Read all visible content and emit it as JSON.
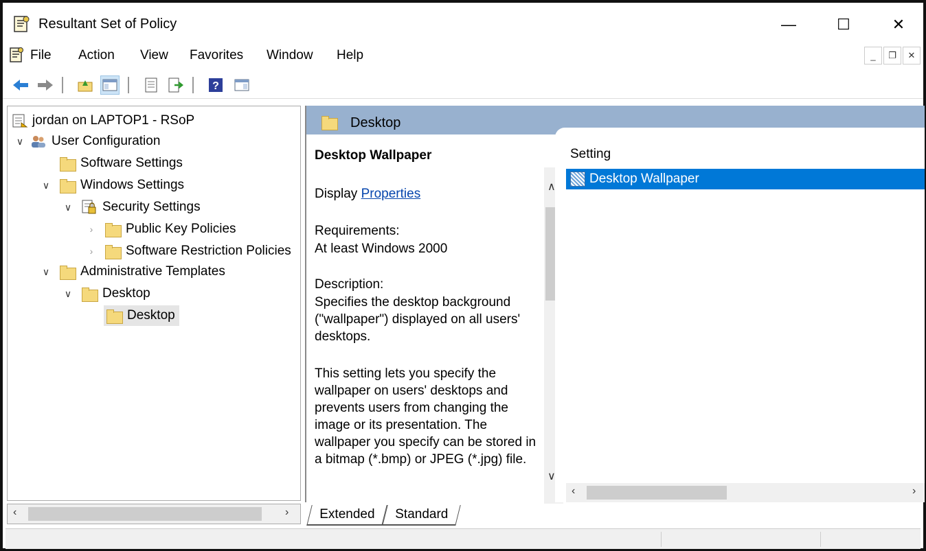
{
  "window": {
    "title": "Resultant Set of Policy",
    "controls": {
      "minimize": "—",
      "maximize": "☐",
      "close": "✕"
    }
  },
  "menu": {
    "items": [
      "File",
      "Action",
      "View",
      "Favorites",
      "Window",
      "Help"
    ],
    "mdi": {
      "minimize": "_",
      "restore": "❐",
      "close": "✕"
    }
  },
  "toolbar": {
    "buttons": [
      "back-arrow-icon",
      "forward-arrow-icon",
      "up-folder-icon",
      "show-hide-tree-icon",
      "properties-icon",
      "export-list-icon",
      "help-icon",
      "show-hide-action-pane-icon"
    ]
  },
  "tree": {
    "root": "jordan on LAPTOP1 - RSoP",
    "user_configuration": "User Configuration",
    "software_settings": "Software Settings",
    "windows_settings": "Windows Settings",
    "security_settings": "Security Settings",
    "public_key_policies": "Public Key Policies",
    "software_restriction": "Software Restriction Policies",
    "administrative_templates": "Administrative Templates",
    "desktop_parent": "Desktop",
    "desktop_child": "Desktop"
  },
  "details": {
    "header": "Desktop",
    "title": "Desktop Wallpaper",
    "display_label": "Display",
    "display_link": "Properties",
    "requirements_label": "Requirements:",
    "requirements_value": "At least Windows 2000",
    "description_label": "Description:",
    "description_text": "Specifies the desktop background (\"wallpaper\") displayed on all users' desktops.",
    "description_more": "This setting lets you specify the wallpaper on users' desktops and prevents users from changing the image or its presentation. The wallpaper you specify can be stored in a bitmap (*.bmp) or JPEG (*.jpg) file."
  },
  "list": {
    "column_header": "Setting",
    "rows": [
      "Desktop Wallpaper"
    ]
  },
  "tabs": {
    "extended": "Extended",
    "standard": "Standard"
  }
}
